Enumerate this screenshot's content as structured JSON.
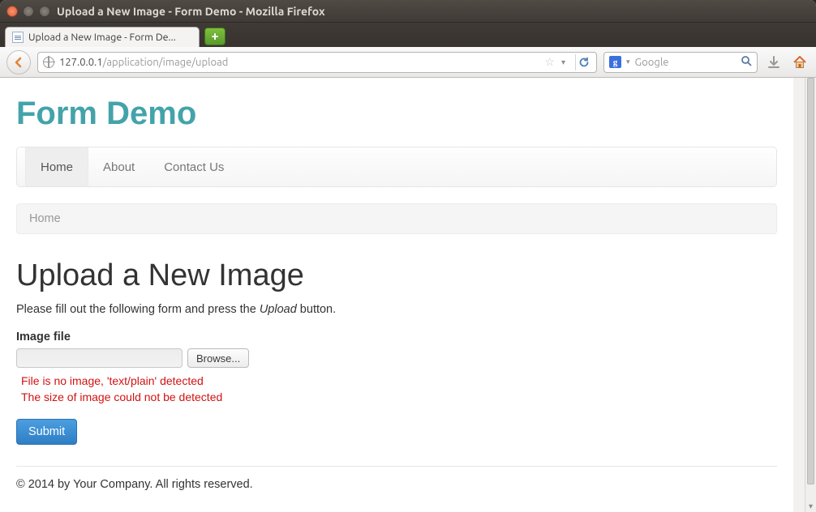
{
  "window": {
    "title": "Upload a New Image - Form Demo - Mozilla Firefox"
  },
  "tab": {
    "label": "Upload a New Image - Form De..."
  },
  "urlbar": {
    "host": "127.0.0.1",
    "path": "/application/image/upload"
  },
  "search": {
    "placeholder": "Google"
  },
  "brand": "Form Demo",
  "nav": {
    "items": [
      {
        "label": "Home",
        "active": true
      },
      {
        "label": "About",
        "active": false
      },
      {
        "label": "Contact Us",
        "active": false
      }
    ]
  },
  "breadcrumb": {
    "items": [
      {
        "label": "Home"
      }
    ]
  },
  "page": {
    "title": "Upload a New Image",
    "lead_pre": "Please fill out the following form and press the ",
    "lead_em": "Upload",
    "lead_post": " button."
  },
  "form": {
    "label": "Image file",
    "browse": "Browse...",
    "errors": [
      "File is no image, 'text/plain' detected",
      "The size of image could not be detected"
    ],
    "submit": "Submit"
  },
  "footer": "© 2014 by Your Company. All rights reserved."
}
